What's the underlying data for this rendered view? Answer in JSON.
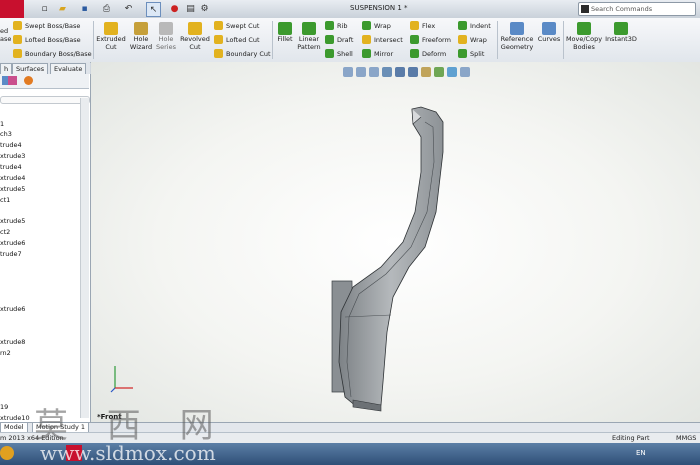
{
  "window": {
    "title": "SUSPENSION 1 *"
  },
  "search": {
    "placeholder": "Search Commands"
  },
  "ribbon": {
    "left_stub_1": "ed",
    "left_stub_2": "ase",
    "swept_boss": "Swept Boss/Base",
    "lofted_boss": "Lofted Boss/Base",
    "boundary_boss": "Boundary Boss/Base",
    "extruded_cut_1": "Extruded",
    "extruded_cut_2": "Cut",
    "hole_wizard_1": "Hole",
    "hole_wizard_2": "Wizard",
    "hole_series_1": "Hole",
    "hole_series_2": "Series",
    "revolved_cut_1": "Revolved",
    "revolved_cut_2": "Cut",
    "swept_cut": "Swept Cut",
    "lofted_cut": "Lofted Cut",
    "boundary_cut": "Boundary Cut",
    "fillet": "Fillet",
    "linear_pattern_1": "Linear",
    "linear_pattern_2": "Pattern",
    "rib": "Rib",
    "draft": "Draft",
    "shell": "Shell",
    "wrap": "Wrap",
    "intersect": "Intersect",
    "mirror": "Mirror",
    "flex": "Flex",
    "freeform": "Freeform",
    "deform": "Deform",
    "indent": "Indent",
    "wrap2": "Wrap",
    "split": "Split",
    "ref_geom_1": "Reference",
    "ref_geom_2": "Geometry",
    "curves": "Curves",
    "move_copy_1": "Move/Copy",
    "move_copy_2": "Bodies",
    "instant3d": "Instant3D"
  },
  "manager_tabs": [
    "h",
    "Surfaces",
    "Evaluate"
  ],
  "tree_items": [
    "1",
    "ch3",
    "trude4",
    "xtrude3",
    "trude4",
    "xtrude4",
    "xtrude5",
    "ct1",
    "xtrude5",
    "ct2",
    "xtrude6",
    "trude7",
    "xtrude6",
    "xtrude8",
    "rn2",
    "19",
    "xtrude10"
  ],
  "bottom_tabs": [
    "Model",
    "Motion Study 1"
  ],
  "status": {
    "edition": "m 2013 x64 Edition",
    "mode": "Editing Part",
    "units": "MMGS"
  },
  "view_label": "*Front",
  "taskbar": {
    "lang": "EN"
  },
  "watermark": {
    "chars": "莫 西 网",
    "url": "www.sldmox.com"
  },
  "colors": {
    "ribbon_bg": "#e9edf2",
    "accent_green": "#3c9a2e",
    "accent_yellow": "#e2b21f",
    "part_gray": "#9a9fa3"
  }
}
